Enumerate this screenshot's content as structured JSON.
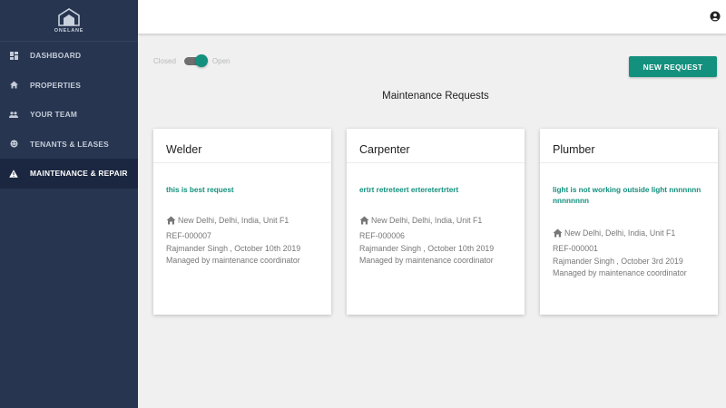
{
  "brand": {
    "name": "ONELANE"
  },
  "sidebar": {
    "items": [
      {
        "label": "DASHBOARD",
        "icon": "dashboard-icon",
        "active": false
      },
      {
        "label": "PROPERTIES",
        "icon": "home-icon",
        "active": false
      },
      {
        "label": "YOUR TEAM",
        "icon": "team-icon",
        "active": false
      },
      {
        "label": "TENANTS & LEASES",
        "icon": "tenants-icon",
        "active": false
      },
      {
        "label": "MAINTENANCE & REPAIR",
        "icon": "warning-icon",
        "active": true
      }
    ]
  },
  "topbar": {
    "account_icon": "account-icon"
  },
  "filter": {
    "off_label": "Closed",
    "on_label": "Open",
    "state": "Open"
  },
  "actions": {
    "new_request": "NEW REQUEST"
  },
  "page": {
    "title": "Maintenance Requests"
  },
  "colors": {
    "accent": "#14907e",
    "sidebar_bg": "#273550",
    "sidebar_active": "#1b2740"
  },
  "requests": [
    {
      "trade": "Welder",
      "description": "this is best request",
      "location": "New Delhi, Delhi, India, Unit F1",
      "ref": "REF-000007",
      "created": "Rajmander Singh , October 10th 2019",
      "managed_by": "Managed by maintenance coordinator"
    },
    {
      "trade": "Carpenter",
      "description": "ertrt retreteert erteretertrtert",
      "location": "New Delhi, Delhi, India, Unit F1",
      "ref": "REF-000006",
      "created": "Rajmander Singh , October 10th 2019",
      "managed_by": "Managed by maintenance coordinator"
    },
    {
      "trade": "Plumber",
      "description": "light is not working outside light nnnnnnn nnnnnnnn",
      "location": "New Delhi, Delhi, India, Unit F1",
      "ref": "REF-000001",
      "created": "Rajmander Singh , October 3rd 2019",
      "managed_by": "Managed by maintenance coordinator"
    }
  ]
}
